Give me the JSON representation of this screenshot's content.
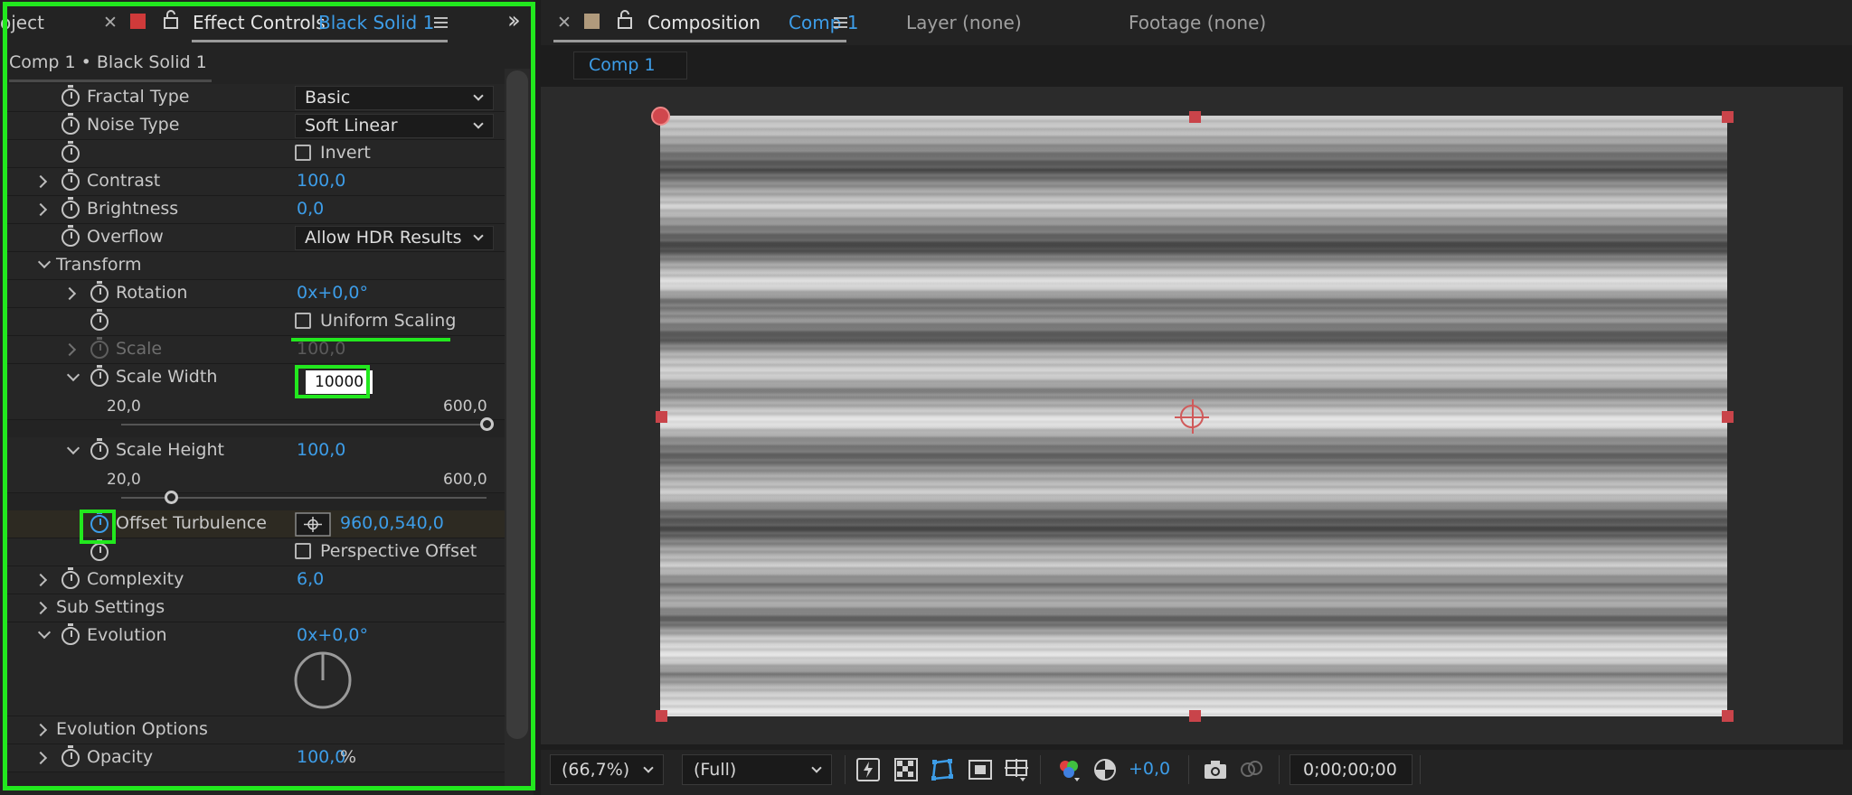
{
  "effect_panel": {
    "tab_left_cut": "oject",
    "tab_title": "Effect Controls",
    "tab_layer": "Black Solid 1",
    "breadcrumb": "Comp 1 • Black Solid 1",
    "rows": {
      "fractal_type": {
        "label": "Fractal Type",
        "value": "Basic"
      },
      "noise_type": {
        "label": "Noise Type",
        "value": "Soft Linear"
      },
      "invert": {
        "label": "Invert"
      },
      "contrast": {
        "label": "Contrast",
        "value": "100,0"
      },
      "brightness": {
        "label": "Brightness",
        "value": "0,0"
      },
      "overflow": {
        "label": "Overflow",
        "value": "Allow HDR Results"
      },
      "transform": {
        "label": "Transform"
      },
      "rotation": {
        "label": "Rotation",
        "value": "0x+0,0°"
      },
      "uniform_scaling": {
        "label": "Uniform Scaling"
      },
      "scale": {
        "label": "Scale",
        "value": "100,0"
      },
      "scale_width": {
        "label": "Scale Width",
        "value": "10000",
        "min": "20,0",
        "max": "600,0",
        "slider_fraction": 1.0
      },
      "scale_height": {
        "label": "Scale Height",
        "value": "100,0",
        "min": "20,0",
        "max": "600,0",
        "slider_fraction": 0.138
      },
      "offset_turbulence": {
        "label": "Offset Turbulence",
        "value": "960,0,540,0"
      },
      "perspective_offset": {
        "label": "Perspective Offset"
      },
      "complexity": {
        "label": "Complexity",
        "value": "6,0"
      },
      "sub_settings": {
        "label": "Sub Settings"
      },
      "evolution": {
        "label": "Evolution",
        "value": "0x+0,0°"
      },
      "evolution_options": {
        "label": "Evolution Options"
      },
      "opacity": {
        "label": "Opacity",
        "value": "100,0",
        "unit": "%"
      }
    }
  },
  "composition_panel": {
    "tab_title": "Composition",
    "tab_comp": "Comp 1",
    "layer_tab": "Layer (none)",
    "footage_tab": "Footage (none)",
    "subtab": "Comp 1",
    "footer": {
      "zoom": "(66,7%)",
      "resolution": "(Full)",
      "exposure": "+0,0",
      "timecode": "0;00;00;00"
    }
  },
  "colors": {
    "accent_blue": "#3d9de8",
    "highlight_green": "#22e81e",
    "handle_red": "#c9444a"
  }
}
